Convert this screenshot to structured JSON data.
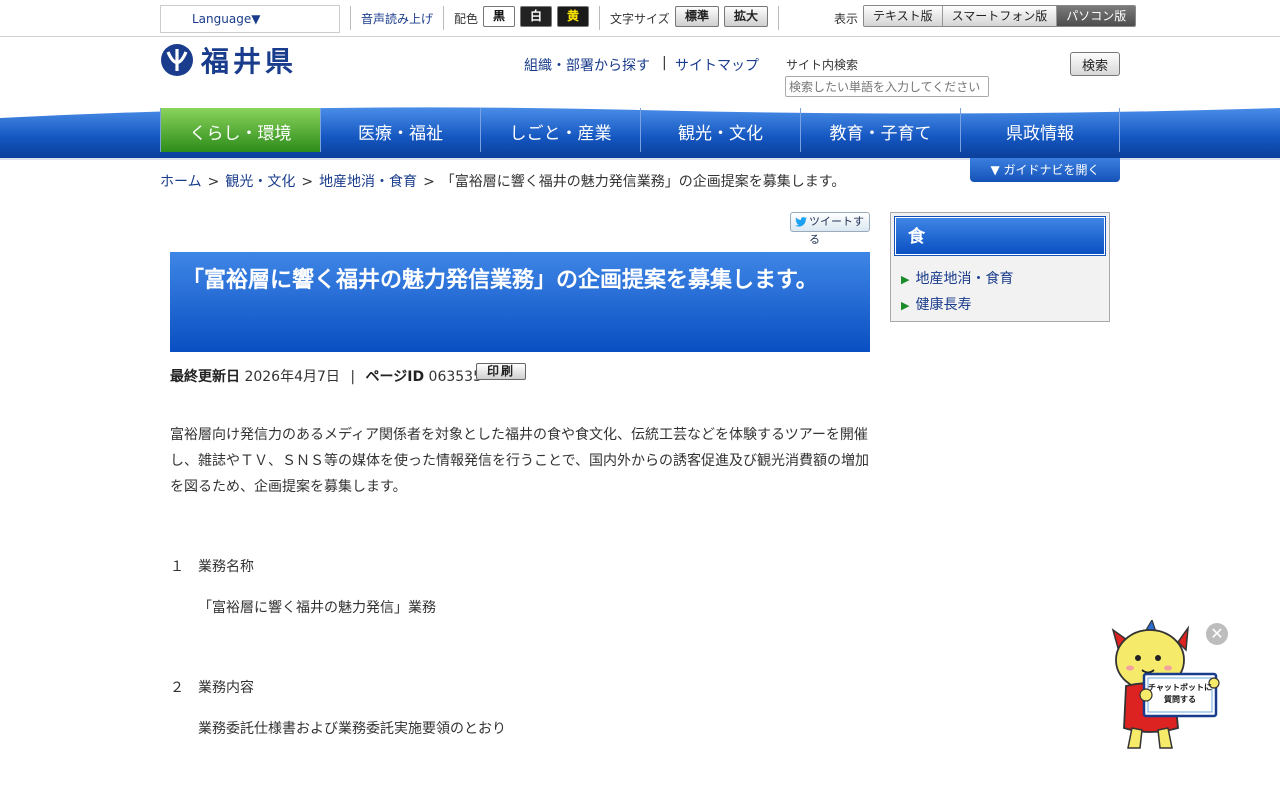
{
  "utility": {
    "language_label": "Language▼",
    "voice_label": "音声読み上げ",
    "color_label": "配色",
    "color_black": "黒",
    "color_white": "白",
    "color_yellow": "黄",
    "font_size_label": "文字サイズ",
    "font_standard": "標準",
    "font_large": "拡大",
    "display_label": "表示",
    "display_text": "テキスト版",
    "display_smartphone": "スマートフォン版",
    "display_pc": "パソコン版"
  },
  "header": {
    "logo_text": "福井県",
    "org_link": "組織・部署から探す",
    "pipe": "|",
    "sitemap_link": "サイトマップ",
    "search_label": "サイト内検索",
    "search_placeholder": "検索したい単語を入力してください",
    "search_button": "検索"
  },
  "nav": {
    "items": [
      "くらし・環境",
      "医療・福祉",
      "しごと・産業",
      "観光・文化",
      "教育・子育て",
      "県政情報"
    ],
    "active_index": 0
  },
  "breadcrumb": {
    "home": "ホーム",
    "level1": "観光・文化",
    "level2": "地産地消・食育",
    "current": "「富裕層に響く福井の魅力発信業務」の企画提案を募集します。",
    "separator": ">"
  },
  "guide_nav_label": "▼ ガイドナビを開く",
  "tweet_label": "ツイートする",
  "article": {
    "title": "「富裕層に響く福井の魅力発信業務」の企画提案を募集します。",
    "updated_label": "最終更新日",
    "updated_value": "2026年4月7日",
    "divider": "|",
    "page_id_label": "ページID",
    "page_id_value": "063535",
    "print_label": "印刷",
    "intro": "富裕層向け発信力のあるメディア関係者を対象とした福井の食や食文化、伝統工芸などを体験するツアーを開催し、雑誌やＴＶ、ＳＮＳ等の媒体を使った情報発信を行うことで、国内外からの誘客促進及び観光消費額の増加を図るため、企画提案を募集します。",
    "section1_heading": "１　業務名称",
    "section1_body": "「富裕層に響く福井の魅力発信」業務",
    "section2_heading": "２　業務内容",
    "section2_body": "業務委託仕様書および業務委託実施要領のとおり"
  },
  "sidebar": {
    "heading": "食",
    "items": [
      "地産地消・食育",
      "健康長寿"
    ]
  },
  "chatbot": {
    "label_line1": "チャットボットに",
    "label_line2": "質問する"
  },
  "colors": {
    "accent_blue": "#0a4fc2",
    "link_blue": "#1a3c8c",
    "nav_active_green": "#2d8c1a"
  }
}
